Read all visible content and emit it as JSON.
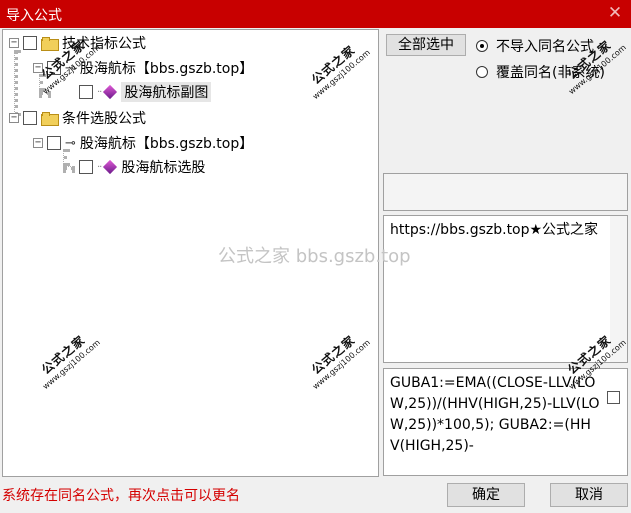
{
  "window": {
    "title": "导入公式",
    "close_glyph": "✕"
  },
  "tree": {
    "nodes": [
      {
        "label": "技术指标公式",
        "expander": "−",
        "icon": "folder-icon",
        "checked": false
      },
      {
        "label": "股海航标【bbs.gszb.top】",
        "expander": "−",
        "icon": "key-icon",
        "checked": false
      },
      {
        "label": "股海航标副图",
        "icon": "gem-icon",
        "checked": false,
        "selected": true
      },
      {
        "label": "条件选股公式",
        "expander": "−",
        "icon": "folder-icon",
        "checked": false
      },
      {
        "label": "股海航标【bbs.gszb.top】",
        "expander": "−",
        "icon": "key-icon",
        "checked": false
      },
      {
        "label": "股海航标选股",
        "icon": "gem-icon",
        "checked": false
      }
    ]
  },
  "buttons": {
    "select_all": "全部选中",
    "ok": "确定",
    "cancel": "取消"
  },
  "options": {
    "skip_same_name": {
      "label": "不导入同名公式",
      "checked": true
    },
    "overwrite_same_name": {
      "label": "覆盖同名(非系统)",
      "checked": false
    }
  },
  "panels": {
    "description_text": "https://bbs.gszb.top★公式之家",
    "code_text": "GUBA1:=EMA((CLOSE-LLV(LOW,25))/(HHV(HIGH,25)-LLV(LOW,25))*100,5);\nGUBA2:=(HHV(HIGH,25)-"
  },
  "status": {
    "message": "系统存在同名公式，再次点击可以更名",
    "color": "#d40000"
  },
  "watermarks": {
    "stamp_text": "公式之家",
    "stamp_url": "www.gszj100.com",
    "center_text": "公式之家 bbs.gszb.top"
  },
  "colors": {
    "titlebar": "#c80000",
    "folder": "#f1cf5a",
    "gem": "#b03ab8"
  }
}
